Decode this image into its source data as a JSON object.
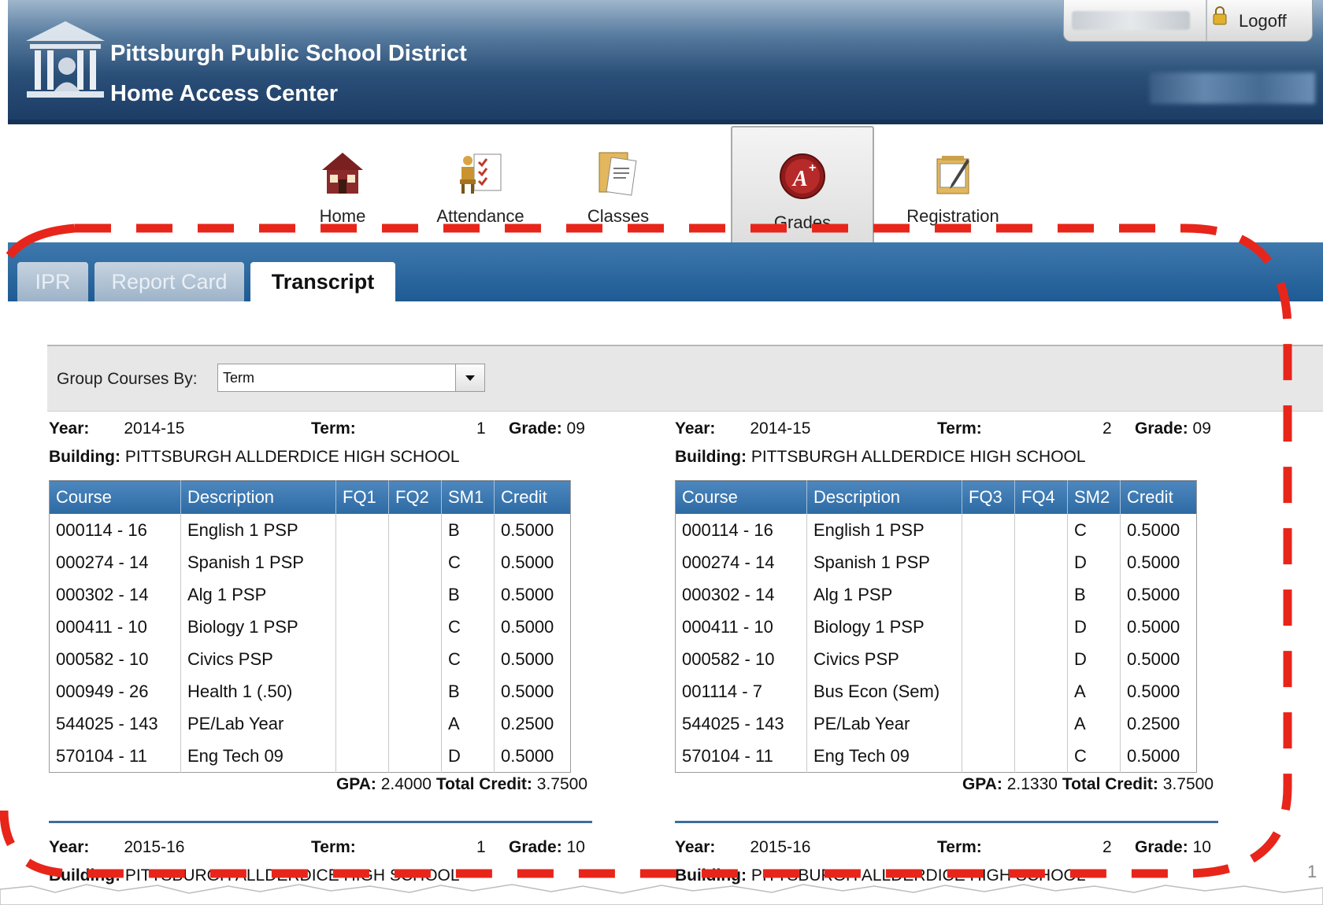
{
  "header": {
    "district": "Pittsburgh Public School District",
    "app": "Home Access Center",
    "logoff": "Logoff"
  },
  "nav": {
    "items": [
      {
        "label": "Home",
        "icon": "house-icon"
      },
      {
        "label": "Attendance",
        "icon": "attendance-icon"
      },
      {
        "label": "Classes",
        "icon": "classes-icon"
      },
      {
        "label": "Grades",
        "icon": "grades-icon"
      },
      {
        "label": "Registration",
        "icon": "registration-icon"
      }
    ],
    "active": "Grades"
  },
  "tabs": [
    {
      "label": "IPR",
      "active": false
    },
    {
      "label": "Report Card",
      "active": false
    },
    {
      "label": "Transcript",
      "active": true
    }
  ],
  "group": {
    "label": "Group Courses By:",
    "value": "Term"
  },
  "labels": {
    "year": "Year:",
    "term": "Term:",
    "grade": "Grade:",
    "building": "Building:",
    "gpa": "GPA:",
    "total_credit": "Total Credit:"
  },
  "terms": [
    {
      "year": "2014-15",
      "term": "1",
      "grade": "09",
      "building": "PITTSBURGH ALLDERDICE HIGH SCHOOL",
      "columns": [
        "Course",
        "Description",
        "FQ1",
        "FQ2",
        "SM1",
        "Credit"
      ],
      "rows": [
        [
          "000114 - 16",
          "English 1 PSP",
          "",
          "",
          "B",
          "0.5000"
        ],
        [
          "000274 - 14",
          "Spanish 1 PSP",
          "",
          "",
          "C",
          "0.5000"
        ],
        [
          "000302 - 14",
          "Alg 1 PSP",
          "",
          "",
          "B",
          "0.5000"
        ],
        [
          "000411 - 10",
          "Biology 1 PSP",
          "",
          "",
          "C",
          "0.5000"
        ],
        [
          "000582 - 10",
          "Civics PSP",
          "",
          "",
          "C",
          "0.5000"
        ],
        [
          "000949 - 26",
          "Health 1 (.50)",
          "",
          "",
          "B",
          "0.5000"
        ],
        [
          "544025 - 143",
          "PE/Lab Year",
          "",
          "",
          "A",
          "0.2500"
        ],
        [
          "570104 - 11",
          "Eng Tech 09",
          "",
          "",
          "D",
          "0.5000"
        ]
      ],
      "gpa": "2.4000",
      "total_credit": "3.7500"
    },
    {
      "year": "2014-15",
      "term": "2",
      "grade": "09",
      "building": "PITTSBURGH ALLDERDICE HIGH SCHOOL",
      "columns": [
        "Course",
        "Description",
        "FQ3",
        "FQ4",
        "SM2",
        "Credit"
      ],
      "rows": [
        [
          "000114 - 16",
          "English 1 PSP",
          "",
          "",
          "C",
          "0.5000"
        ],
        [
          "000274 - 14",
          "Spanish 1 PSP",
          "",
          "",
          "D",
          "0.5000"
        ],
        [
          "000302 - 14",
          "Alg 1 PSP",
          "",
          "",
          "B",
          "0.5000"
        ],
        [
          "000411 - 10",
          "Biology 1 PSP",
          "",
          "",
          "D",
          "0.5000"
        ],
        [
          "000582 - 10",
          "Civics PSP",
          "",
          "",
          "D",
          "0.5000"
        ],
        [
          "001114 - 7",
          "Bus Econ (Sem)",
          "",
          "",
          "A",
          "0.5000"
        ],
        [
          "544025 - 143",
          "PE/Lab Year",
          "",
          "",
          "A",
          "0.2500"
        ],
        [
          "570104 - 11",
          "Eng Tech 09",
          "",
          "",
          "C",
          "0.5000"
        ]
      ],
      "gpa": "2.1330",
      "total_credit": "3.7500"
    }
  ],
  "next_terms": [
    {
      "year": "2015-16",
      "term": "1",
      "grade": "10",
      "building": "PITTSBURGH ALLDERDICE HIGH SCHOOL"
    },
    {
      "year": "2015-16",
      "term": "2",
      "grade": "10",
      "building": "PITTSBURGH ALLDERDICE HIGH SCHOOL"
    }
  ],
  "page_number": "1",
  "colors": {
    "header_dark": "#1b3b63",
    "table_header": "#2d6aa3",
    "highlight": "#e8251a"
  }
}
